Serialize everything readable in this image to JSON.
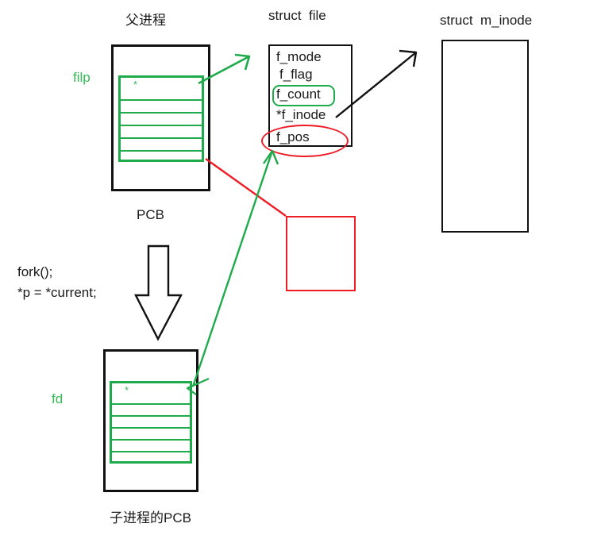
{
  "diagram": {
    "title_parent_process": "父进程",
    "title_struct_file": "struct  file",
    "title_struct_m_inode": "struct  m_inode",
    "label_pcb": "PCB",
    "label_child_pcb": "子进程的PCB",
    "label_filp": "filp",
    "label_fd": "fd",
    "code_line_1": "fork();",
    "code_line_2": "*p = *current;",
    "fd_star": "*"
  },
  "struct_file": {
    "fields": [
      {
        "name": "f_mode"
      },
      {
        "name": "f_flag"
      },
      {
        "name": "f_count"
      },
      {
        "name": "*f_inode"
      },
      {
        "name": "f_pos"
      }
    ]
  },
  "parent_pcb": {
    "rows": [
      "*",
      "",
      "",
      "",
      "",
      ""
    ]
  },
  "child_pcb": {
    "rows": [
      "*",
      "",
      "",
      "",
      "",
      ""
    ]
  },
  "colors": {
    "green": "#1faa4b",
    "green_text": "#33bb55",
    "red": "#ee1c25",
    "black": "#111111"
  }
}
